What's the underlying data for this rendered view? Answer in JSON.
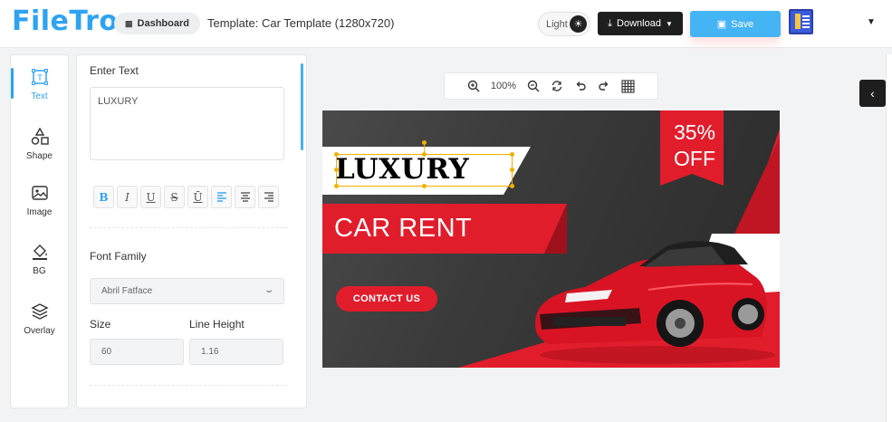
{
  "header": {
    "logo": "FileTro",
    "dashboard_label": "Dashboard",
    "template_title": "Template: Car Template (1280x720)",
    "theme_label": "Light",
    "download_label": "Download",
    "save_label": "Save"
  },
  "rail": {
    "items": [
      {
        "label": "Text",
        "icon": "text-box-icon"
      },
      {
        "label": "Shape",
        "icon": "shapes-icon"
      },
      {
        "label": "Image",
        "icon": "image-icon"
      },
      {
        "label": "BG",
        "icon": "paint-bucket-icon"
      },
      {
        "label": "Overlay",
        "icon": "layers-icon"
      }
    ]
  },
  "panel": {
    "enter_text_label": "Enter Text",
    "text_value": "LUXURY",
    "format_buttons": [
      "B",
      "I",
      "U",
      "S",
      "Ū",
      "align-left",
      "align-center",
      "align-right"
    ],
    "font_family_label": "Font Family",
    "font_family_value": "Abril Fatface",
    "size_label": "Size",
    "size_value": "60",
    "line_height_label": "Line Height",
    "line_height_value": "1.16"
  },
  "toolbar": {
    "zoom_level": "100%"
  },
  "design": {
    "badge_line1": "35%",
    "badge_line2": "OFF",
    "headline": "LUXURY",
    "subheadline": "CAR RENT",
    "cta": "CONTACT US"
  },
  "colors": {
    "accent": "#2ea3f2",
    "red": "#e11d2c",
    "dark": "#1e1e1e"
  }
}
